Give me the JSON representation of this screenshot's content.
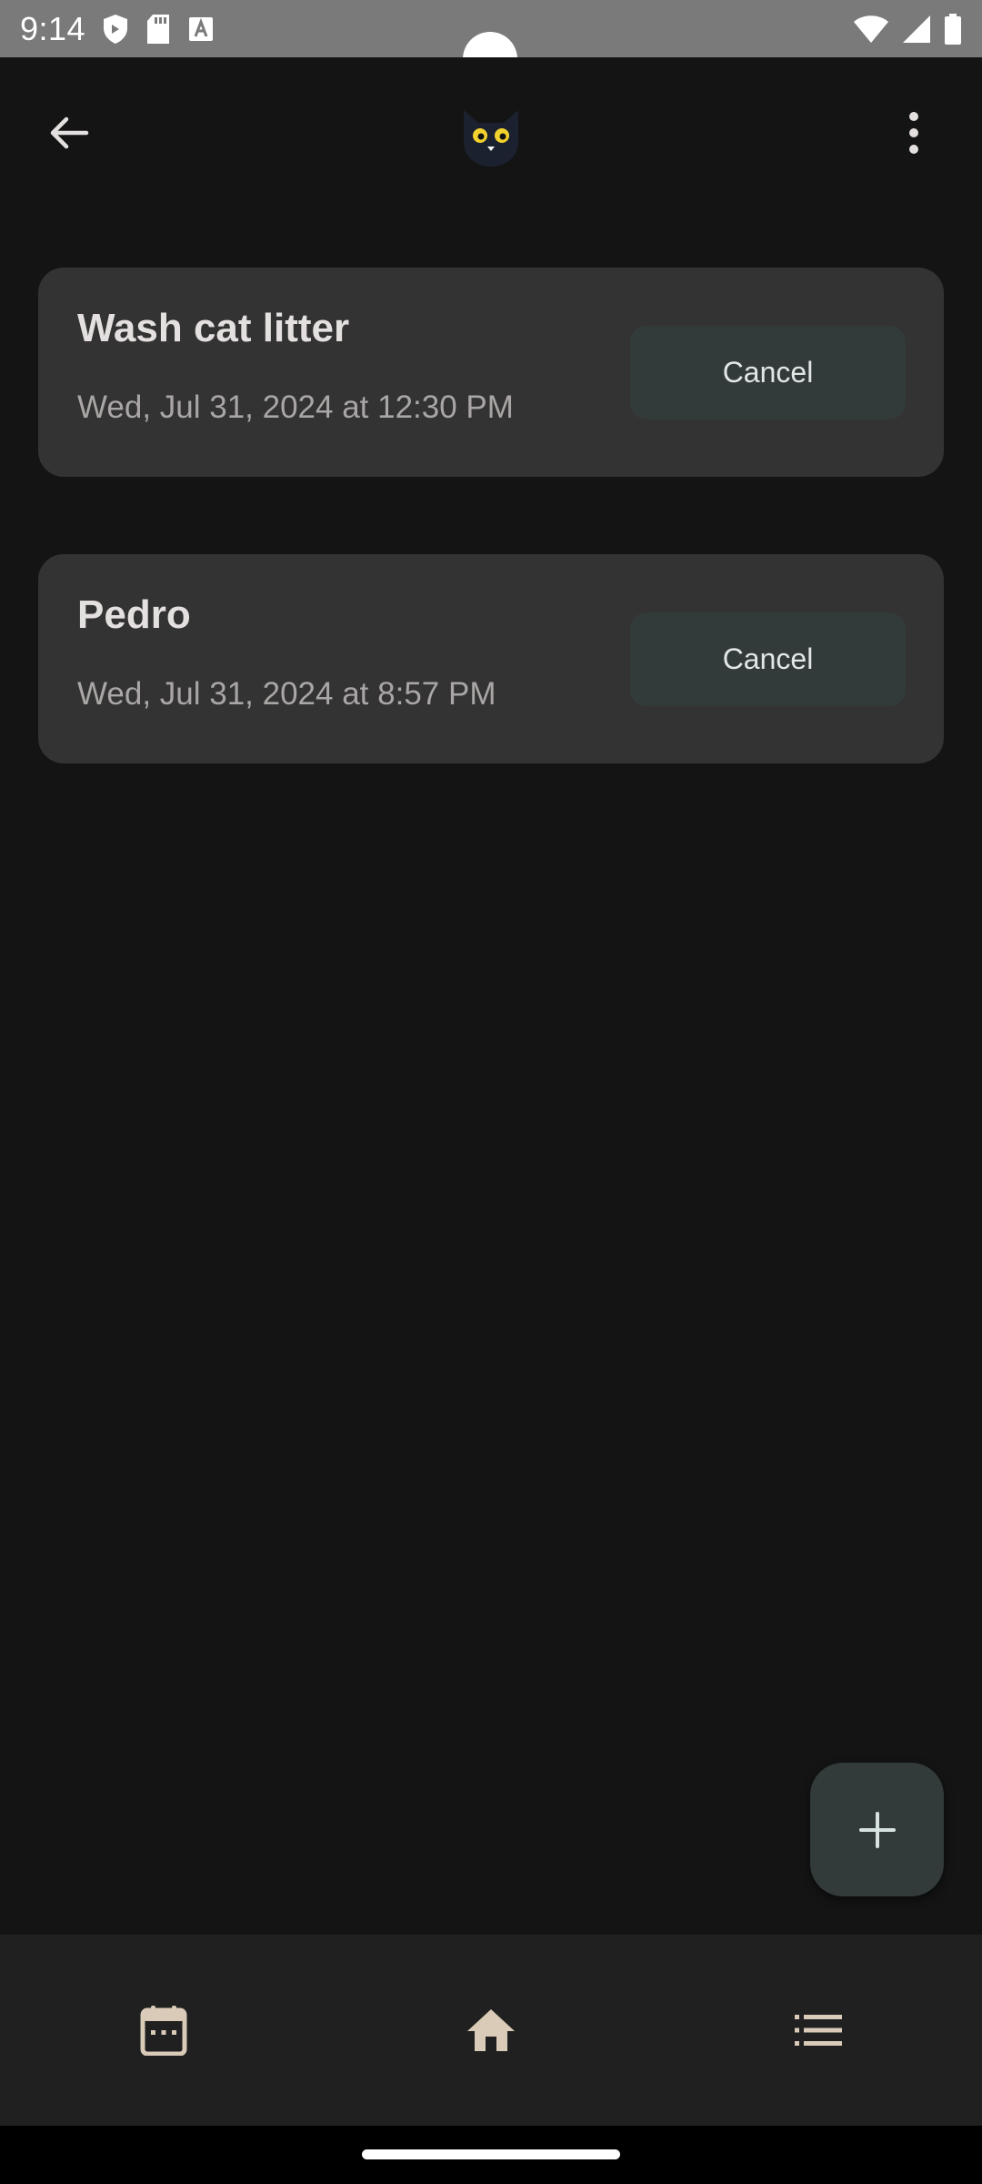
{
  "status_bar": {
    "time": "9:14",
    "left_icons": [
      "shield-icon",
      "sd-card-icon",
      "font-icon"
    ],
    "right_icons": [
      "wifi-icon",
      "signal-icon",
      "battery-icon"
    ]
  },
  "app_bar": {
    "back_icon": "arrow-back-icon",
    "logo": "black-cat-logo",
    "menu_icon": "more-vert-icon"
  },
  "reminders": [
    {
      "title": "Wash cat litter",
      "date": "Wed, Jul 31, 2024 at 12:30 PM",
      "cancel_label": "Cancel"
    },
    {
      "title": "Pedro",
      "date": "Wed, Jul 31, 2024 at 8:57 PM",
      "cancel_label": "Cancel"
    }
  ],
  "fab": {
    "icon": "add-icon"
  },
  "bottom_nav": {
    "items": [
      {
        "icon": "calendar-icon"
      },
      {
        "icon": "home-icon"
      },
      {
        "icon": "list-icon"
      }
    ]
  },
  "colors": {
    "background": "#141414",
    "card": "#333333",
    "button": "#323a3a",
    "nav": "#202020",
    "icon_tint": "#d9cbb8",
    "status_bar": "#7a7a7a"
  }
}
